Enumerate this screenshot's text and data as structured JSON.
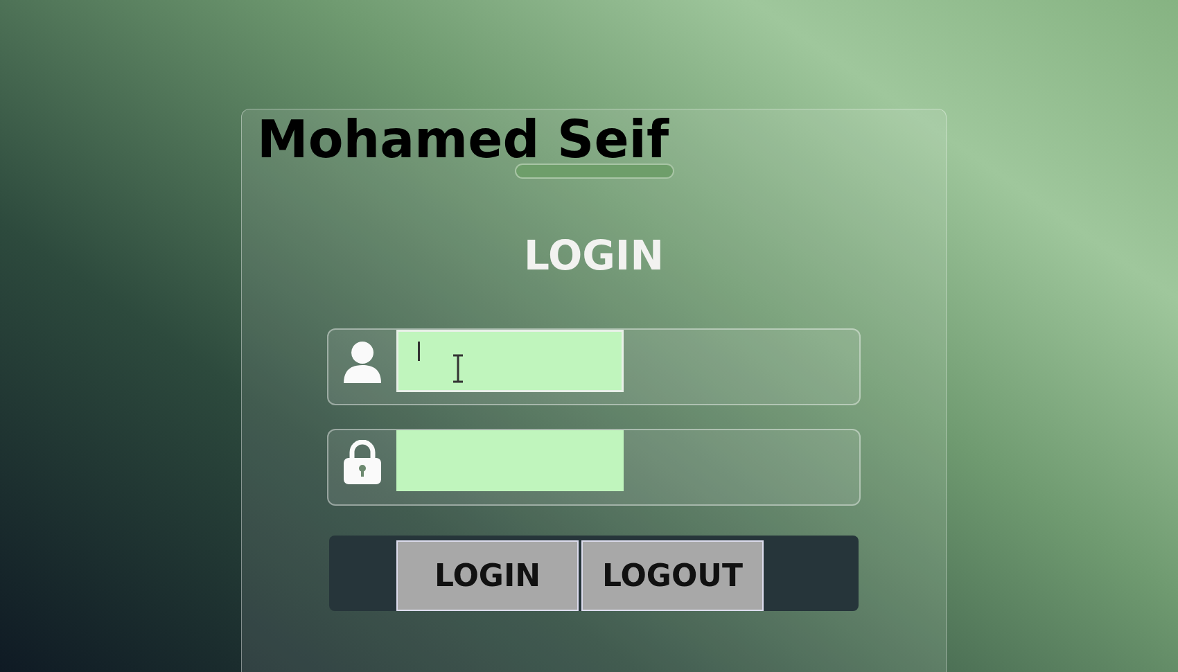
{
  "title": "Mohamed Seif",
  "form": {
    "heading": "LOGIN",
    "fields": [
      {
        "kind": "username",
        "focused": true
      },
      {
        "kind": "password",
        "focused": false
      }
    ],
    "buttons": [
      "LOGIN",
      "LOGOUT"
    ]
  }
}
